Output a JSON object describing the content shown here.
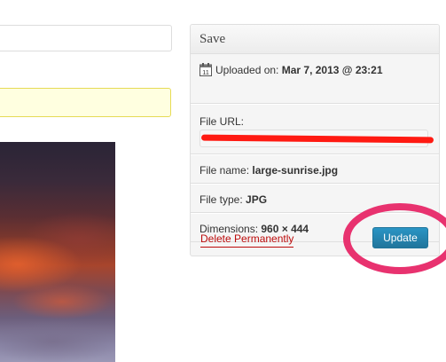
{
  "left_panel": {
    "title_input_value": "",
    "notice_text": ""
  },
  "save_box": {
    "title": "Save",
    "uploaded": {
      "label": "Uploaded on:",
      "value": "Mar 7, 2013 @ 23:21",
      "icon": "calendar-icon",
      "icon_text": "11"
    },
    "file_url": {
      "label": "File URL:",
      "value": ""
    },
    "file_name": {
      "label": "File name:",
      "value": "large-sunrise.jpg"
    },
    "file_type": {
      "label": "File type:",
      "value": "JPG"
    },
    "dimensions": {
      "label": "Dimensions:",
      "value": "960 × 444"
    },
    "delete_label": "Delete Permanently",
    "update_label": "Update"
  },
  "colors": {
    "update_button": "#21759b",
    "delete_link": "#bc0b0b",
    "redaction": "#ff1a12",
    "highlight_ring": "#e8326f",
    "notice_background": "#ffffe0"
  }
}
